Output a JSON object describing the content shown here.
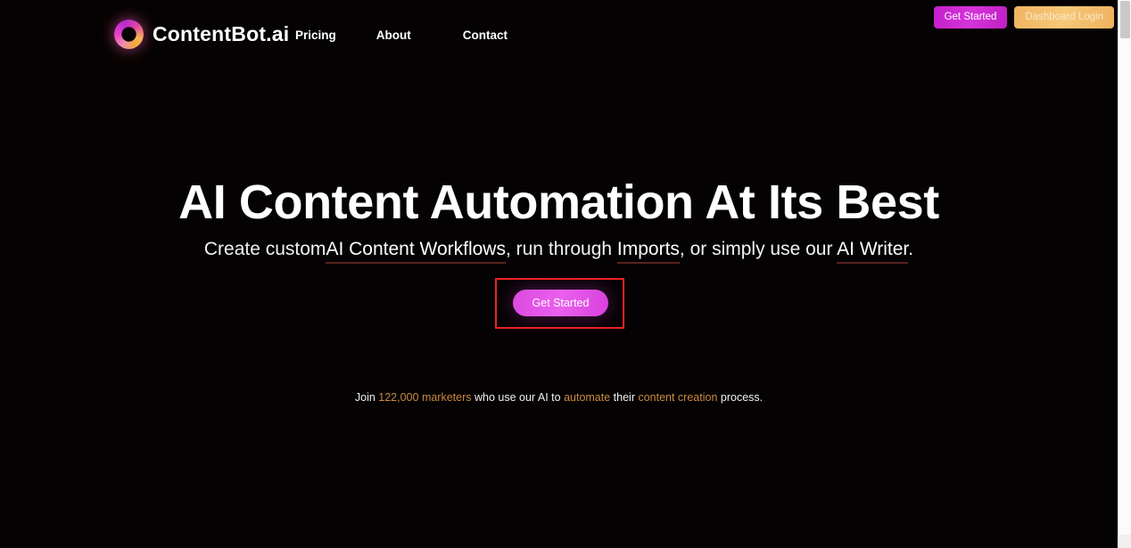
{
  "brand": {
    "name": "ContentBot.ai",
    "logo_icon": "gradient-ring-logo-icon"
  },
  "nav": {
    "links": [
      {
        "label": "Pricing"
      },
      {
        "label": "About"
      },
      {
        "label": "Contact"
      }
    ],
    "actions": {
      "get_started": "Get Started",
      "dashboard_login": "Dashboard Login"
    }
  },
  "hero": {
    "title": "AI Content Automation At Its Best",
    "subtitle": {
      "lead": "Create custom",
      "link1": "AI Content Workflows",
      "mid1": ", run through ",
      "link2": "Imports",
      "mid2": ", or simply use our ",
      "link3": "AI Writer",
      "tail": "."
    },
    "cta_label": "Get Started",
    "social_proof": {
      "part1": "Join ",
      "accent1": "122,000 marketers",
      "part2": " who use our AI to ",
      "accent2": "automate",
      "part3": " their ",
      "accent3": "content creation",
      "part4": " process."
    }
  },
  "colors": {
    "background": "#050203",
    "accent_magenta": "#d534d9",
    "accent_orange": "#f0b460",
    "highlight_box": "#ee2222",
    "text_accent": "#c98a3f"
  }
}
